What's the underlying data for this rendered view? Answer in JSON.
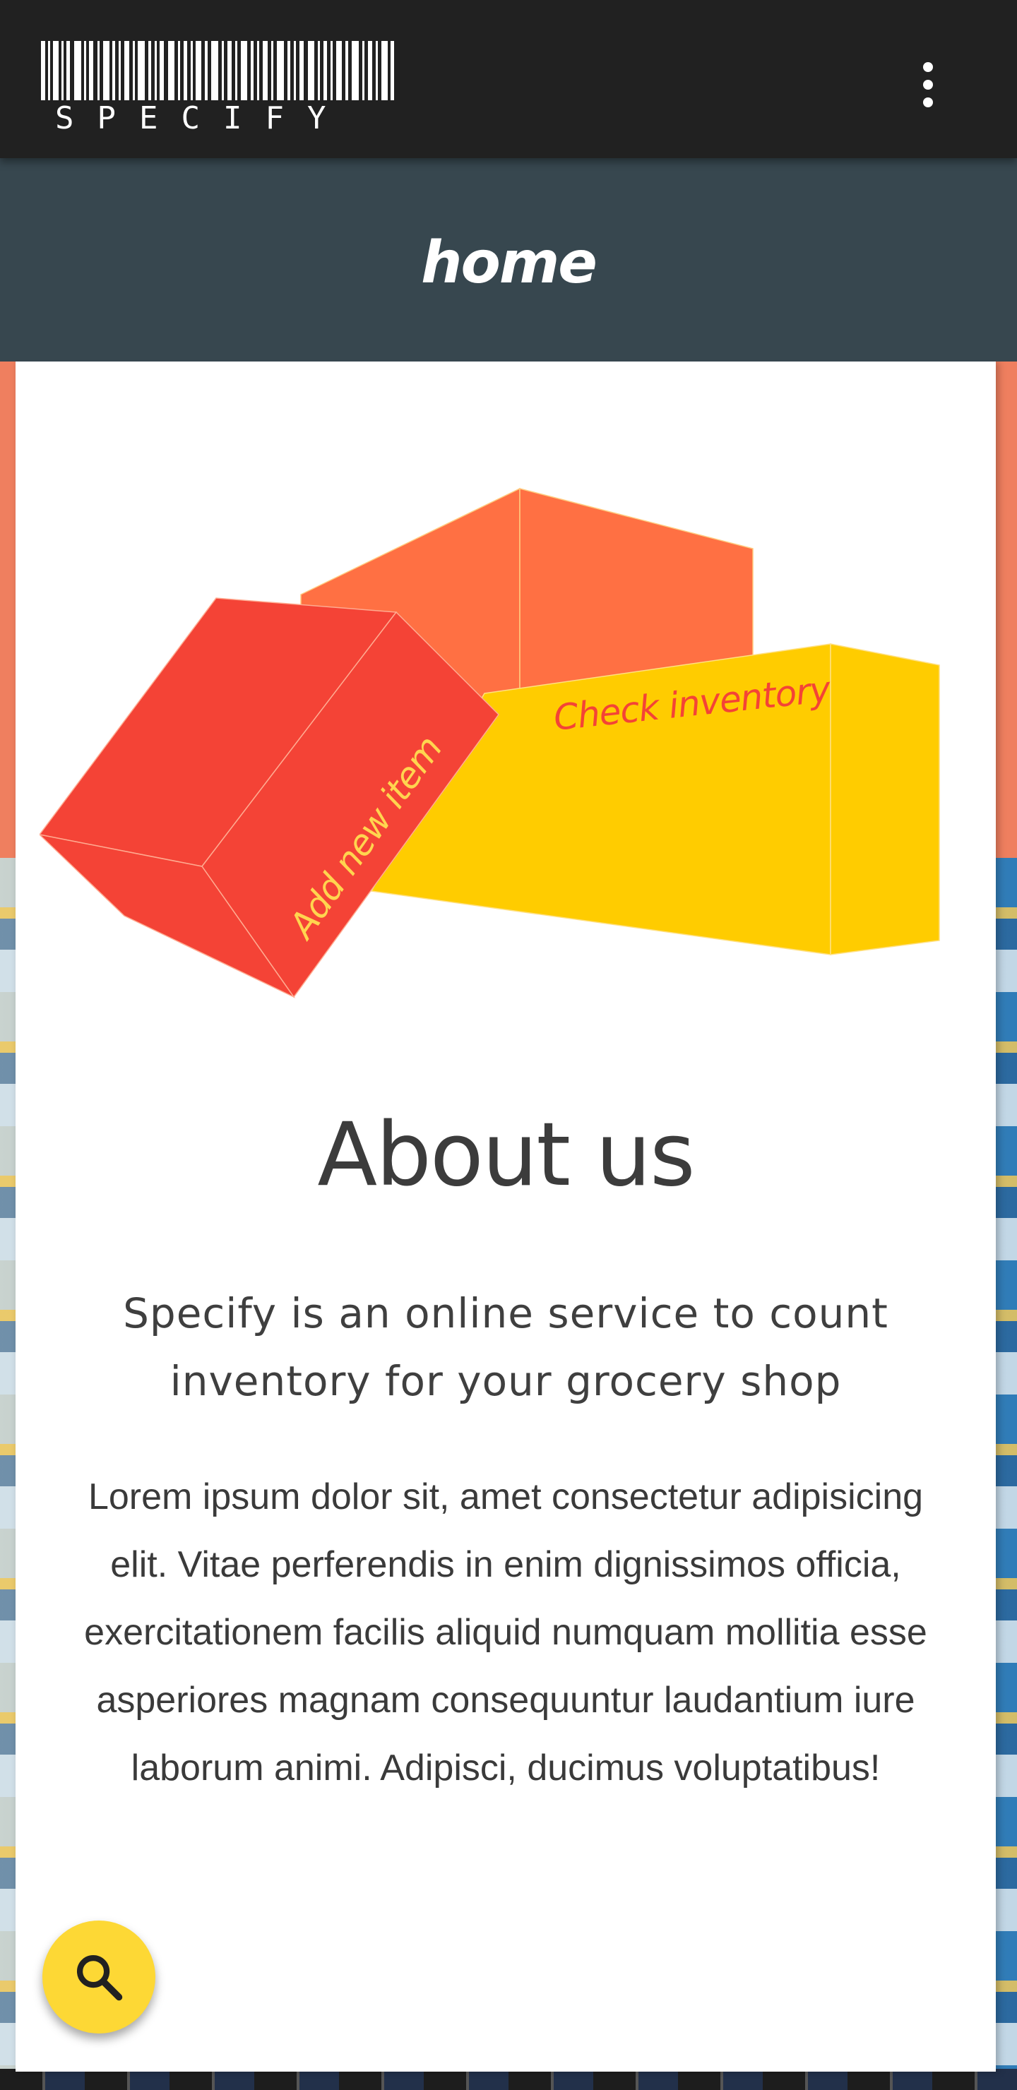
{
  "app": {
    "logo_text": "SPECIFY",
    "menu_icon": "more-vert-icon"
  },
  "header": {
    "title": "home"
  },
  "hero": {
    "add_item_label": "Add new item",
    "check_inventory_label": "Check inventory",
    "colors": {
      "red_box": "#f44336",
      "orange_box": "#ff7043",
      "yellow_box": "#ffcc00",
      "red_text": "#f44336",
      "yellow_text": "#ffd54f"
    }
  },
  "about": {
    "heading": "About us",
    "subtitle": "Specify is an online service to count inventory for your grocery shop",
    "body": "Lorem ipsum dolor sit, amet consectetur adipisicing elit. Vitae perferendis in enim dignissimos officia, exercitationem facilis aliquid numquam mollitia esse asperiores magnam consequuntur laudantium iure laborum animi. Adipisci, ducimus voluptatibus!"
  },
  "fab": {
    "icon": "search-icon",
    "color": "#fdd835"
  },
  "theme": {
    "appbar_color": "#212121",
    "title_band_color": "#37474f",
    "accent_orange": "#ef7f5f"
  }
}
